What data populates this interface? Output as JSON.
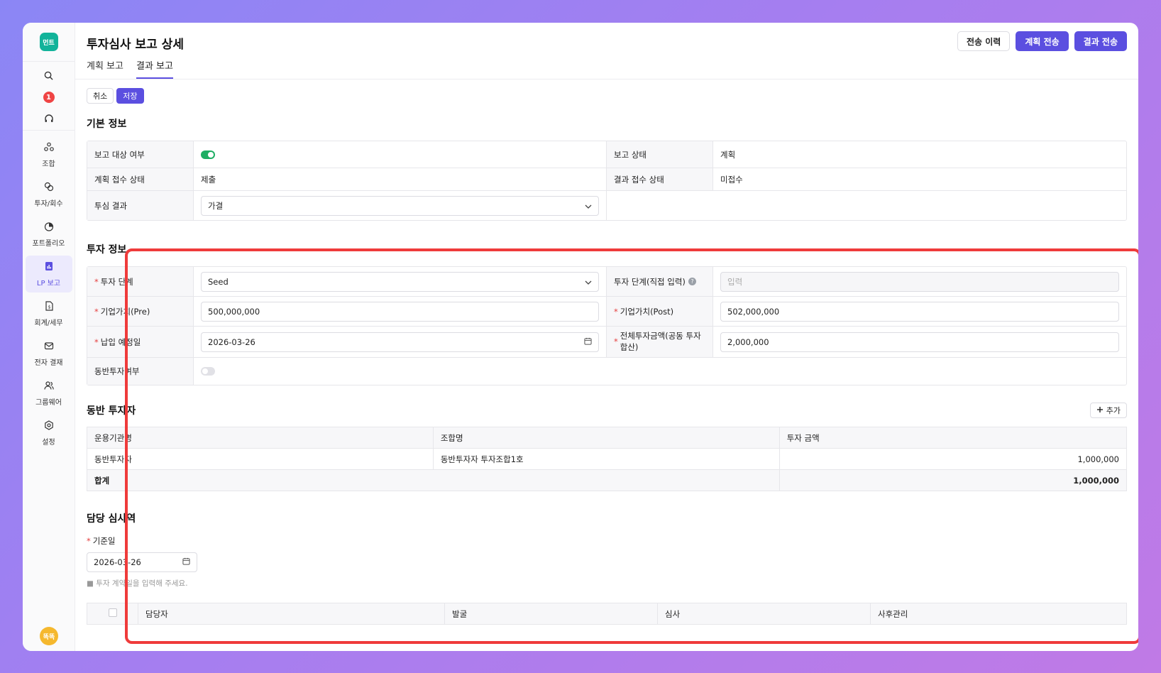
{
  "app": {
    "logo_text": "먼트",
    "avatar_text": "똑똑",
    "notification_count": "1"
  },
  "sidebar": {
    "items": [
      {
        "label": "조합",
        "icon": "cluster-icon"
      },
      {
        "label": "투자/회수",
        "icon": "exchange-icon"
      },
      {
        "label": "포트폴리오",
        "icon": "pie-chart-icon"
      },
      {
        "label": "LP 보고",
        "icon": "report-icon",
        "active": true
      },
      {
        "label": "회계/세무",
        "icon": "document-dollar-icon"
      },
      {
        "label": "전자 결재",
        "icon": "mail-icon"
      },
      {
        "label": "그룹웨어",
        "icon": "users-icon"
      },
      {
        "label": "설정",
        "icon": "gear-icon"
      }
    ]
  },
  "header": {
    "title": "투자심사 보고 상세",
    "tabs": [
      {
        "label": "계획 보고"
      },
      {
        "label": "결과 보고",
        "active": true
      }
    ],
    "actions": {
      "history": "전송 이력",
      "send_plan": "계획 전송",
      "send_result": "결과 전송"
    }
  },
  "toolbar": {
    "cancel": "취소",
    "save": "저장"
  },
  "basic_info": {
    "title": "기본 정보",
    "report_target_label": "보고 대상 여부",
    "report_status_label": "보고 상태",
    "report_status_value": "계획",
    "plan_receipt_label": "계획 접수 상태",
    "plan_receipt_value": "제출",
    "result_receipt_label": "결과 접수 상태",
    "result_receipt_value": "미접수",
    "review_result_label": "투심 결과",
    "review_result_value": "가결"
  },
  "investment_info": {
    "title": "투자 정보",
    "stage_label": "투자 단계",
    "stage_value": "Seed",
    "stage_manual_label": "투자 단계(직접 입력)",
    "stage_manual_placeholder": "입력",
    "pre_label": "기업가치(Pre)",
    "pre_value": "500,000,000",
    "post_label": "기업가치(Post)",
    "post_value": "502,000,000",
    "payment_date_label": "납입 예정일",
    "payment_date_value": "2026-03-26",
    "total_amount_label": "전체투자금액(공동 투자 합산)",
    "total_amount_value": "2,000,000",
    "co_invest_label": "동반투자여부"
  },
  "co_investors": {
    "title": "동반 투자자",
    "add_label": "추가",
    "columns": [
      "운용기관명",
      "조합명",
      "투자 금액"
    ],
    "rows": [
      {
        "org": "동반투자자",
        "fund": "동반투자자 투자조합1호",
        "amount": "1,000,000"
      }
    ],
    "total_label": "합계",
    "total_amount": "1,000,000"
  },
  "reviewers": {
    "title": "담당 심사역",
    "base_date_label": "기준일",
    "base_date_value": "2026-03-26",
    "hint": "투자 계약일을 입력해 주세요.",
    "columns": [
      "담당자",
      "발굴",
      "심사",
      "사후관리"
    ]
  },
  "colors": {
    "accent": "#5b4fe0",
    "highlight": "#ef3b3b",
    "toggle_on": "#1fae64"
  }
}
